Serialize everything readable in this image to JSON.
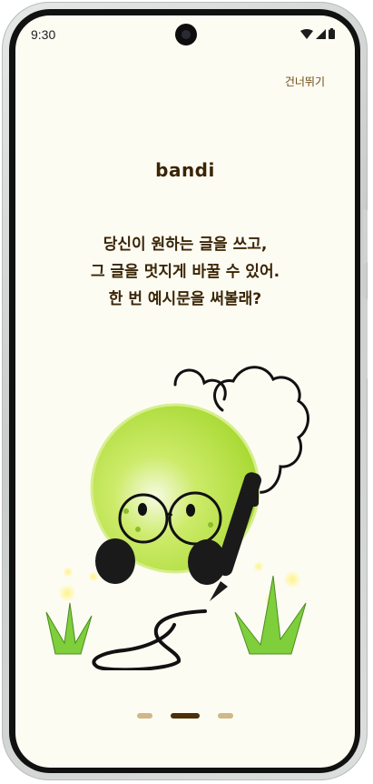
{
  "status_bar": {
    "time": "9:30"
  },
  "skip_label": "건너뛰기",
  "logo_text": "bandi",
  "headline": {
    "line1": "당신이 원하는 글을 쓰고,",
    "line2": "그 글을 멋지게 바꿀 수 있어.",
    "line3": "한 번 예시문을 써볼래?"
  },
  "pager": {
    "current": 2,
    "total": 3
  },
  "colors": {
    "background": "#fdfcf3",
    "text": "#3a2506",
    "accent": "#6b4a12",
    "character": "#b6e23f",
    "dot_active": "#4a2f08",
    "dot_inactive": "#cfb78a"
  },
  "icons": [
    "wifi-icon",
    "signal-icon",
    "battery-icon",
    "camera-icon",
    "pen-icon",
    "grass-icon"
  ]
}
